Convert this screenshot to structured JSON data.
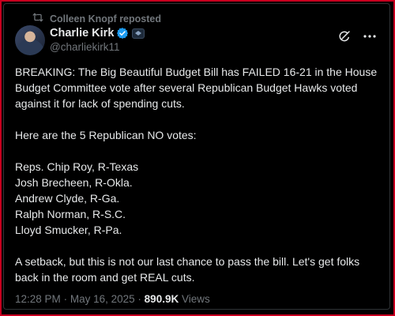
{
  "repost": {
    "label": "Colleen Knopf reposted",
    "icon": "repost-icon"
  },
  "author": {
    "display_name": "Charlie Kirk",
    "handle": "@charliekirk11",
    "verified_color": "#1d9bf0"
  },
  "tweet": {
    "paragraphs": [
      "BREAKING: The Big Beautiful Budget Bill has FAILED 16-21 in the House Budget Committee vote after several Republican Budget Hawks voted against it for lack of spending cuts.",
      "Here are the 5 Republican NO votes:",
      "Reps. Chip Roy, R-Texas",
      "Josh Brecheen, R-Okla.",
      "Andrew Clyde, R-Ga.",
      "Ralph Norman, R-S.C.",
      "Lloyd Smucker, R-Pa.",
      "A setback, but this is not our last chance to pass the bill. Let's get folks back in the room and get REAL cuts."
    ]
  },
  "meta": {
    "time": "12:28 PM",
    "separator": "·",
    "date": "May 16, 2025",
    "views_count": "890.9K",
    "views_label": "Views"
  },
  "colors": {
    "background": "#000000",
    "text": "#e7e9ea",
    "muted": "#71767b",
    "frame_border": "#c8001e"
  }
}
